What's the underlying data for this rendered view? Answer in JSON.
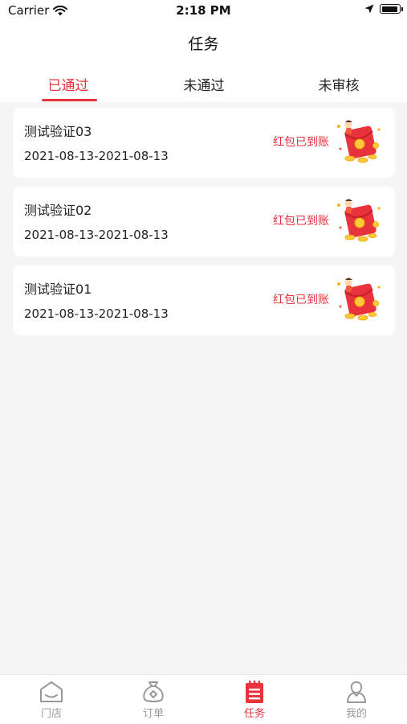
{
  "status_bar": {
    "carrier": "Carrier",
    "time": "2:18 PM",
    "battery_level": 0.95
  },
  "nav": {
    "title": "任务"
  },
  "tabs": [
    {
      "label": "已通过",
      "active": true
    },
    {
      "label": "未通过",
      "active": false
    },
    {
      "label": "未审核",
      "active": false
    }
  ],
  "tasks": [
    {
      "title": "测试验证03",
      "date_range": "2021-08-13-2021-08-13",
      "status": "红包已到账",
      "icon": "red-envelope-icon"
    },
    {
      "title": "测试验证02",
      "date_range": "2021-08-13-2021-08-13",
      "status": "红包已到账",
      "icon": "red-envelope-icon"
    },
    {
      "title": "测试验证01",
      "date_range": "2021-08-13-2021-08-13",
      "status": "红包已到账",
      "icon": "red-envelope-icon"
    }
  ],
  "bottom_tabs": [
    {
      "label": "门店",
      "icon": "store-icon",
      "active": false
    },
    {
      "label": "订单",
      "icon": "money-bag-icon",
      "active": false
    },
    {
      "label": "任务",
      "icon": "task-list-icon",
      "active": true
    },
    {
      "label": "我的",
      "icon": "profile-icon",
      "active": false
    }
  ],
  "colors": {
    "accent": "#e8323c",
    "inactive": "#999999",
    "background": "#f5f5f5"
  }
}
